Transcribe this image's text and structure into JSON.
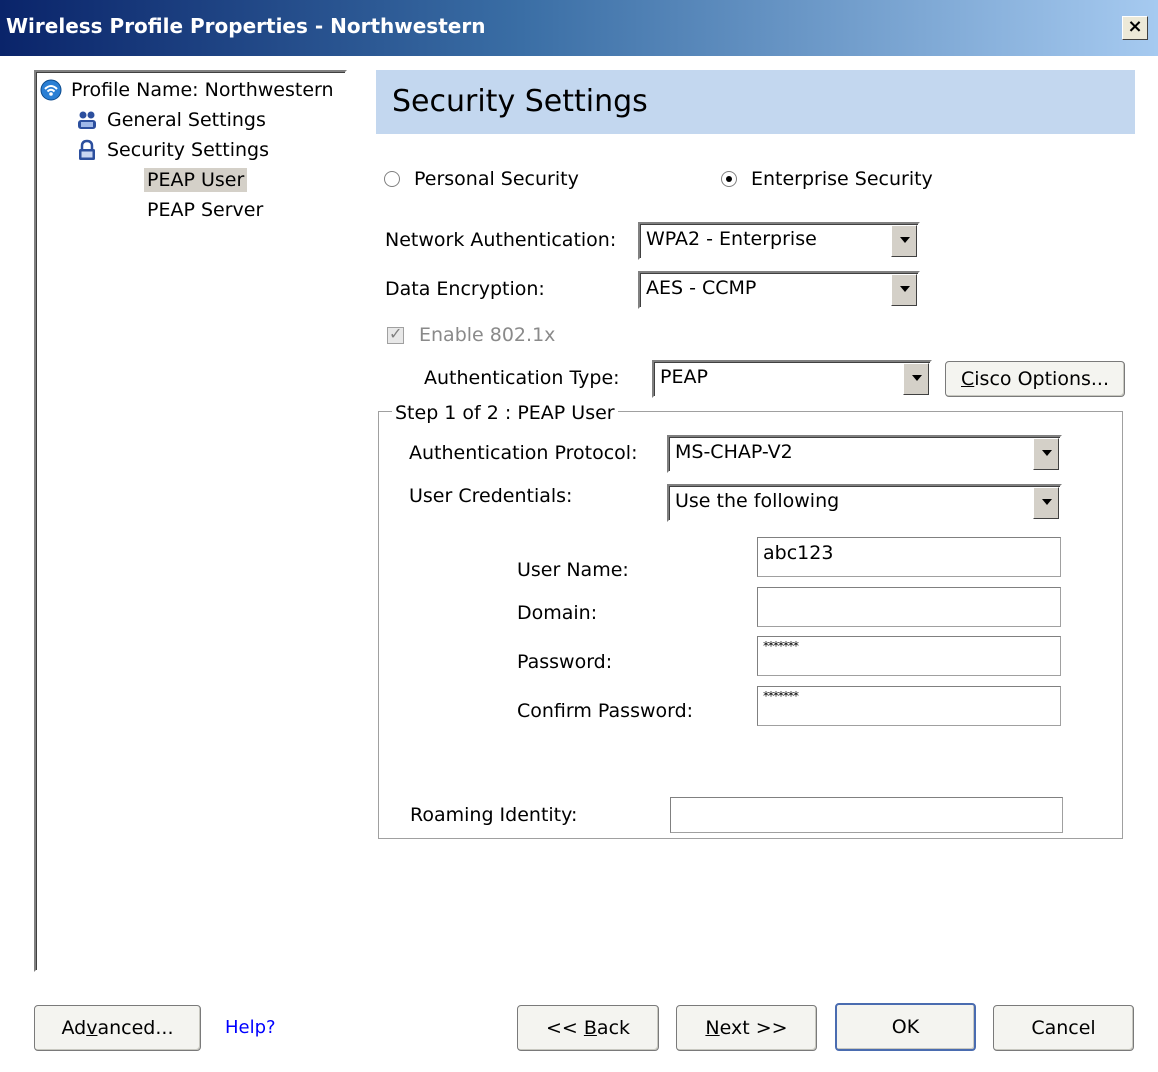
{
  "window": {
    "title": "Wireless Profile Properties - Northwestern",
    "close_glyph": "×"
  },
  "tree": {
    "items": [
      {
        "label": "Profile Name: Northwestern",
        "icon": "wireless-icon"
      },
      {
        "label": "General Settings",
        "icon": "users-icon"
      },
      {
        "label": "Security Settings",
        "icon": "lock-icon"
      },
      {
        "label": "PEAP User",
        "selected": true
      },
      {
        "label": "PEAP Server"
      }
    ]
  },
  "header": {
    "title": "Security Settings"
  },
  "security_mode": {
    "personal_label": "Personal Security",
    "enterprise_label": "Enterprise Security",
    "selected": "Enterprise Security"
  },
  "network_auth": {
    "label": "Network Authentication:",
    "value": "WPA2 - Enterprise"
  },
  "data_encryption": {
    "label": "Data Encryption:",
    "value": "AES - CCMP"
  },
  "enable_8021x": {
    "label": "Enable 802.1x",
    "checked": true,
    "disabled": true
  },
  "auth_type": {
    "label": "Authentication Type:",
    "value": "PEAP"
  },
  "cisco_options": {
    "prefix": "C",
    "rest": "isco Options..."
  },
  "step_group": {
    "legend": "Step 1 of 2 : PEAP User",
    "auth_protocol": {
      "label": "Authentication Protocol:",
      "value": "MS-CHAP-V2"
    },
    "user_credentials": {
      "label": "User Credentials:",
      "value": "Use the following"
    },
    "user_name": {
      "label": "User Name:",
      "value": "abc123"
    },
    "domain": {
      "label": "Domain:",
      "value": ""
    },
    "password": {
      "label": "Password:",
      "value": "*******"
    },
    "confirm_password": {
      "label": "Confirm Password:",
      "value": "*******"
    },
    "roaming_identity": {
      "label": "Roaming Identity:",
      "value": ""
    }
  },
  "footer": {
    "advanced": {
      "pre": "Ad",
      "accel": "v",
      "post": "anced..."
    },
    "help": "Help?",
    "back": {
      "pre": "<< ",
      "accel": "B",
      "post": "ack"
    },
    "next": {
      "accel": "N",
      "post": "ext >>"
    },
    "ok": "OK",
    "cancel": "Cancel"
  },
  "colors": {
    "titlebar_start": "#0a246a",
    "header_band": "#c3d7ef",
    "link": "#0000ff"
  }
}
